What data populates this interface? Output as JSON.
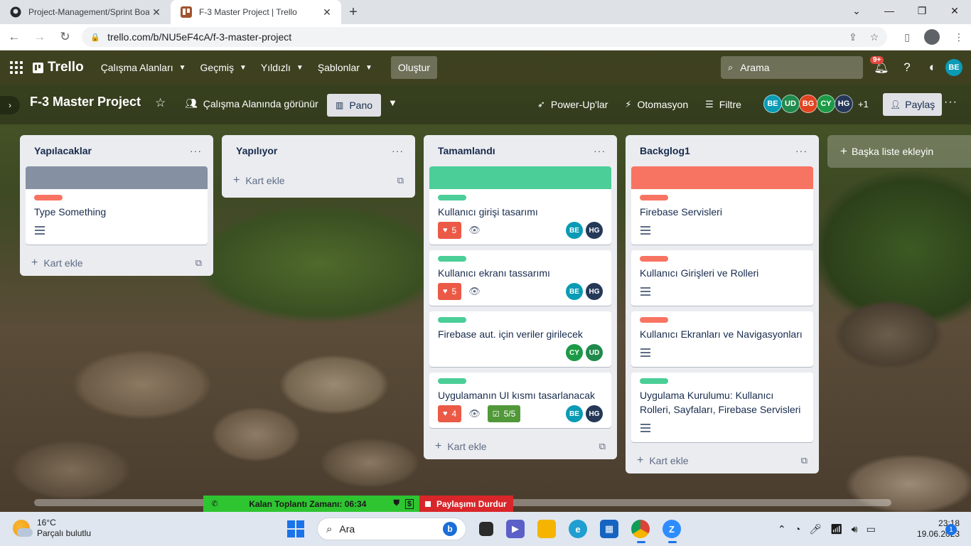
{
  "browser": {
    "tabs": [
      {
        "title": "Project-Management/Sprint Boa",
        "active": false
      },
      {
        "title": "F-3 Master Project | Trello",
        "active": true
      }
    ],
    "url": "trello.com/b/NU5eF4cA/f-3-master-project",
    "profile_initial": "B"
  },
  "header": {
    "logo": "Trello",
    "menu": [
      "Çalışma Alanları",
      "Geçmiş",
      "Yıldızlı",
      "Şablonlar"
    ],
    "create": "Oluştur",
    "search_placeholder": "Arama",
    "notifications_badge": "9+",
    "user_initials": "BE"
  },
  "board": {
    "title": "F-3 Master Project",
    "visibility": "Çalışma Alanında görünür",
    "view": "Pano",
    "powerups": "Power-Up'lar",
    "automation": "Otomasyon",
    "filter": "Filtre",
    "members": [
      {
        "initials": "BE",
        "color": "#0a9bb5"
      },
      {
        "initials": "UD",
        "color": "#1f8a4c"
      },
      {
        "initials": "BG",
        "color": "#e0431f"
      },
      {
        "initials": "CY",
        "color": "#1c9a45"
      },
      {
        "initials": "HG",
        "color": "#253858"
      }
    ],
    "more_members": "+1",
    "share": "Paylaş"
  },
  "lists": [
    {
      "title": "Yapılacaklar",
      "cards": [
        {
          "cover": "#8590a2",
          "label": "#f87462",
          "title": "Type Something",
          "description": true
        }
      ],
      "add_card": "Kart ekle"
    },
    {
      "title": "Yapılıyor",
      "cards": [],
      "add_card": "Kart ekle"
    },
    {
      "title": "Tamamlandı",
      "cards": [
        {
          "cover": "#4bce97",
          "label": "#4bce97",
          "title": "Kullanıcı girişi tasarımı",
          "votes": "5",
          "watch": true,
          "members": [
            "BE",
            "HG"
          ]
        },
        {
          "label": "#4bce97",
          "title": "Kullanıcı ekranı tassarımı",
          "votes": "5",
          "watch": true,
          "members": [
            "BE",
            "HG"
          ]
        },
        {
          "label": "#4bce97",
          "title": "Firebase aut. için veriler girilecek",
          "members": [
            "CY",
            "UD"
          ]
        },
        {
          "label": "#4bce97",
          "title": "Uygulamanın UI kısmı tasarlanacak",
          "votes": "4",
          "watch": true,
          "checklist": "5/5",
          "members": [
            "BE",
            "HG"
          ]
        }
      ],
      "add_card": "Kart ekle"
    },
    {
      "title": "Backglog1",
      "cards": [
        {
          "cover": "#f87462",
          "label": "#f87462",
          "title": "Firebase Servisleri",
          "description": true
        },
        {
          "label": "#f87462",
          "title": "Kullanıcı Girişleri ve Rolleri",
          "description": true
        },
        {
          "label": "#f87462",
          "title": "Kullanıcı Ekranları ve Navigasyonları",
          "description": true
        },
        {
          "label": "#4bce97",
          "title": "Uygulama Kurulumu: Kullanıcı Rolleri, Sayfaları, Firebase Servisleri",
          "description": true
        }
      ],
      "add_card": "Kart ekle"
    }
  ],
  "add_list": "Başka liste ekleyin",
  "meeting": {
    "remaining": "Kalan Toplantı Zamanı: 06:34",
    "stop_share": "Paylaşımı Durdur"
  },
  "taskbar": {
    "temperature": "16°C",
    "weather": "Parçalı bulutlu",
    "search": "Ara",
    "time": "23:18",
    "date": "19.06.2023",
    "notifications": "1"
  }
}
